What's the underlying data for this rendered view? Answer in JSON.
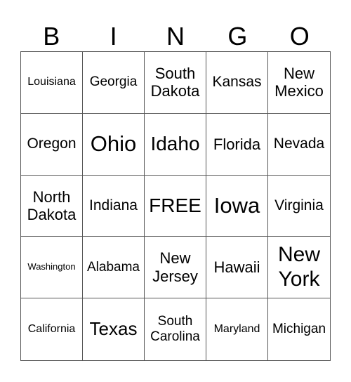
{
  "header": [
    "B",
    "I",
    "N",
    "G",
    "O"
  ],
  "cells": [
    {
      "text": "Louisiana",
      "size": "s16"
    },
    {
      "text": "Georgia",
      "size": "s19"
    },
    {
      "text": "South Dakota",
      "size": "s22"
    },
    {
      "text": "Kansas",
      "size": "s21"
    },
    {
      "text": "New Mexico",
      "size": "s22"
    },
    {
      "text": "Oregon",
      "size": "s21"
    },
    {
      "text": "Ohio",
      "size": "s31"
    },
    {
      "text": "Idaho",
      "size": "s28"
    },
    {
      "text": "Florida",
      "size": "s22"
    },
    {
      "text": "Nevada",
      "size": "s21"
    },
    {
      "text": "North Dakota",
      "size": "s22"
    },
    {
      "text": "Indiana",
      "size": "s21"
    },
    {
      "text": "FREE",
      "size": "s28"
    },
    {
      "text": "Iowa",
      "size": "s31"
    },
    {
      "text": "Virginia",
      "size": "s21"
    },
    {
      "text": "Washington",
      "size": "s13"
    },
    {
      "text": "Alabama",
      "size": "s19"
    },
    {
      "text": "New Jersey",
      "size": "s22"
    },
    {
      "text": "Hawaii",
      "size": "s22"
    },
    {
      "text": "New York",
      "size": "s30"
    },
    {
      "text": "California",
      "size": "s16"
    },
    {
      "text": "Texas",
      "size": "s26"
    },
    {
      "text": "South Carolina",
      "size": "s19"
    },
    {
      "text": "Maryland",
      "size": "s16"
    },
    {
      "text": "Michigan",
      "size": "s19"
    }
  ]
}
